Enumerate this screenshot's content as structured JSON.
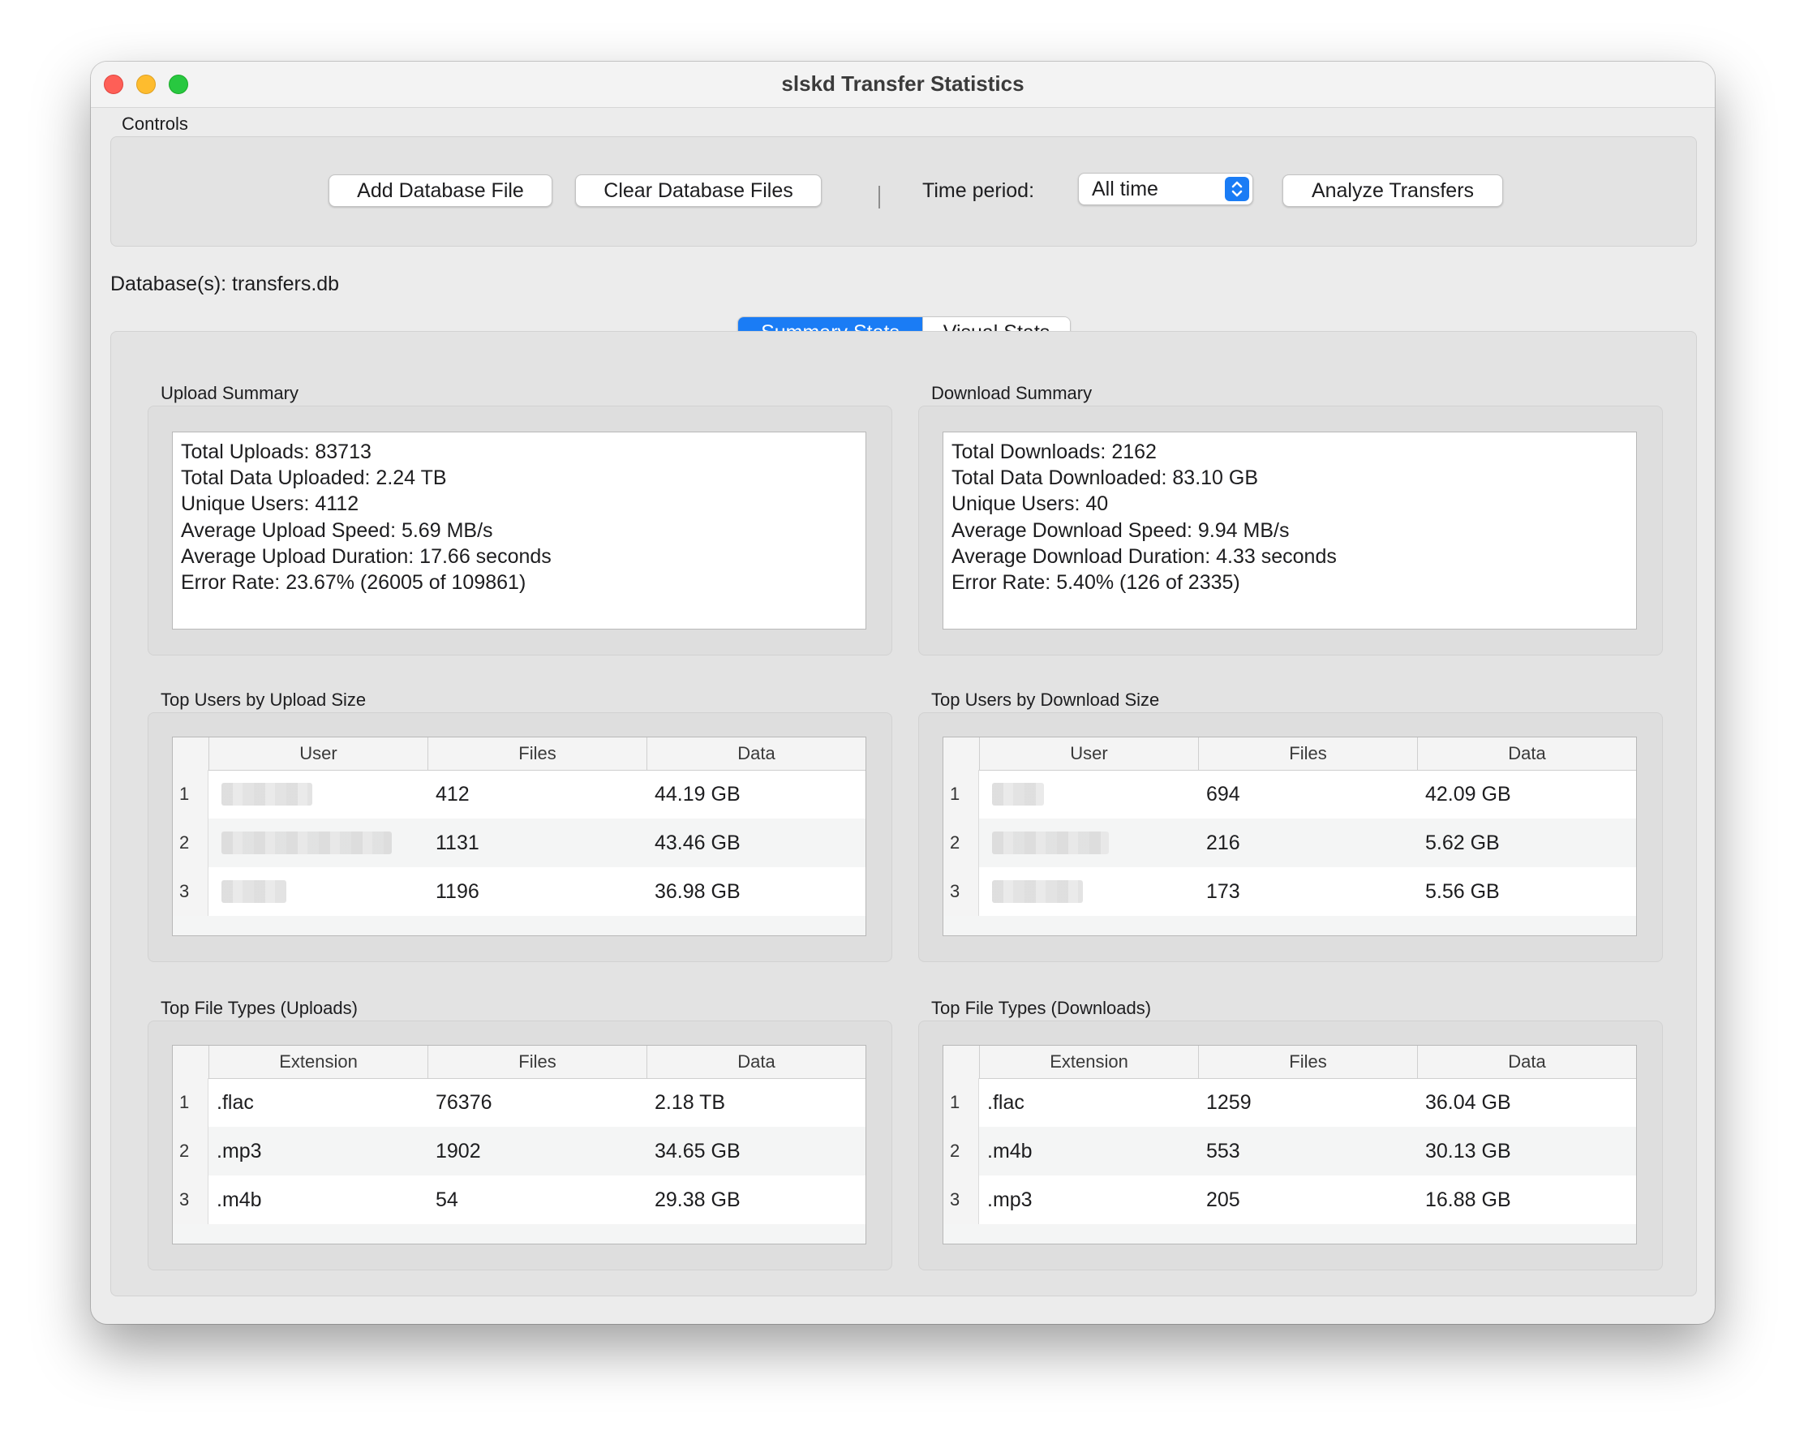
{
  "window": {
    "title": "slskd Transfer Statistics"
  },
  "controls": {
    "group_label": "Controls",
    "add_db_label": "Add Database File",
    "clear_db_label": "Clear Database Files",
    "time_period_label": "Time period:",
    "time_period_value": "All time",
    "analyze_label": "Analyze Transfers"
  },
  "database_label": "Database(s): transfers.db",
  "tabs": [
    {
      "label": "Summary Stats",
      "active": true
    },
    {
      "label": "Visual Stats",
      "active": false
    }
  ],
  "upload_summary": {
    "title": "Upload Summary",
    "lines": [
      "Total Uploads: 83713",
      "Total Data Uploaded: 2.24 TB",
      "Unique Users: 4112",
      "Average Upload Speed: 5.69 MB/s",
      "Average Upload Duration: 17.66 seconds",
      "Error Rate: 23.67% (26005 of 109861)"
    ]
  },
  "download_summary": {
    "title": "Download Summary",
    "lines": [
      "Total Downloads: 2162",
      "Total Data Downloaded: 83.10 GB",
      "Unique Users: 40",
      "Average Download Speed: 9.94 MB/s",
      "Average Download Duration: 4.33 seconds",
      "Error Rate: 5.40% (126 of 2335)"
    ]
  },
  "top_users_upload": {
    "title": "Top Users by Upload Size",
    "columns": [
      "User",
      "Files",
      "Data"
    ],
    "rows": [
      {
        "num": "1",
        "user": "",
        "files": "412",
        "data": "44.19 GB"
      },
      {
        "num": "2",
        "user": "",
        "files": "1131",
        "data": "43.46 GB"
      },
      {
        "num": "3",
        "user": "",
        "files": "1196",
        "data": "36.98 GB"
      }
    ]
  },
  "top_users_download": {
    "title": "Top Users by Download Size",
    "columns": [
      "User",
      "Files",
      "Data"
    ],
    "rows": [
      {
        "num": "1",
        "user": "",
        "files": "694",
        "data": "42.09 GB"
      },
      {
        "num": "2",
        "user": "",
        "files": "216",
        "data": "5.62 GB"
      },
      {
        "num": "3",
        "user": "",
        "files": "173",
        "data": "5.56 GB"
      }
    ]
  },
  "file_types_upload": {
    "title": "Top File Types (Uploads)",
    "columns": [
      "Extension",
      "Files",
      "Data"
    ],
    "rows": [
      {
        "num": "1",
        "ext": ".flac",
        "files": "76376",
        "data": "2.18 TB"
      },
      {
        "num": "2",
        "ext": ".mp3",
        "files": "1902",
        "data": "34.65 GB"
      },
      {
        "num": "3",
        "ext": ".m4b",
        "files": "54",
        "data": "29.38 GB"
      }
    ]
  },
  "file_types_download": {
    "title": "Top File Types (Downloads)",
    "columns": [
      "Extension",
      "Files",
      "Data"
    ],
    "rows": [
      {
        "num": "1",
        "ext": ".flac",
        "files": "1259",
        "data": "36.04 GB"
      },
      {
        "num": "2",
        "ext": ".m4b",
        "files": "553",
        "data": "30.13 GB"
      },
      {
        "num": "3",
        "ext": ".mp3",
        "files": "205",
        "data": "16.88 GB"
      }
    ]
  },
  "colors": {
    "accent": "#1a7cf5",
    "window_bg": "#ececec",
    "group_bg": "#e3e3e3"
  }
}
